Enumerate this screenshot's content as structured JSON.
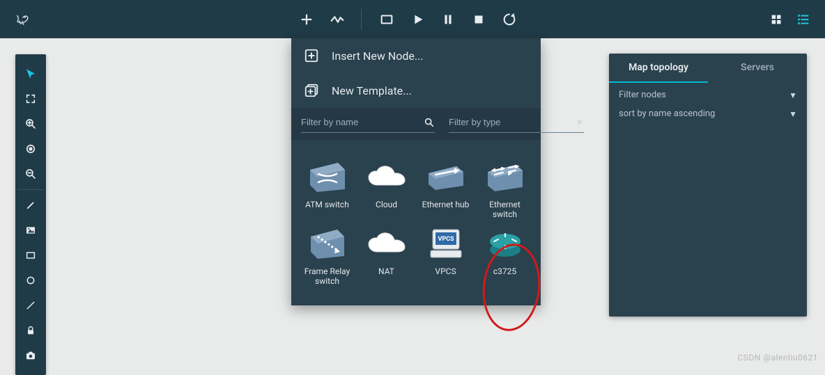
{
  "toolbar": {
    "icons": [
      "add",
      "activity",
      "fit",
      "play",
      "pause",
      "stop",
      "reload"
    ],
    "right_icons": [
      "grid-view",
      "menu"
    ]
  },
  "sidebar": {
    "groups": [
      [
        "cursor",
        "fullscreen",
        "zoom-in",
        "target",
        "zoom-out"
      ],
      [
        "pencil",
        "image",
        "rectangle",
        "circle",
        "line",
        "lock",
        "camera"
      ]
    ]
  },
  "dropdown": {
    "items": [
      {
        "icon": "insert-node",
        "label": "Insert New Node..."
      },
      {
        "icon": "new-template",
        "label": "New Template..."
      }
    ],
    "filter_name_placeholder": "Filter by name",
    "filter_type_placeholder": "Filter by type",
    "nodes": [
      {
        "id": "atm-switch",
        "label": "ATM switch",
        "shape": "switch-blue"
      },
      {
        "id": "cloud",
        "label": "Cloud",
        "shape": "cloud"
      },
      {
        "id": "ethernet-hub",
        "label": "Ethernet hub",
        "shape": "hub-blue"
      },
      {
        "id": "ethernet-switch",
        "label": "Ethernet switch",
        "shape": "switch-arrows"
      },
      {
        "id": "frame-relay",
        "label": "Frame Relay switch",
        "shape": "fr-switch"
      },
      {
        "id": "nat",
        "label": "NAT",
        "shape": "cloud"
      },
      {
        "id": "vpcs",
        "label": "VPCS",
        "shape": "vpcs"
      },
      {
        "id": "c3725",
        "label": "c3725",
        "shape": "router-teal"
      }
    ]
  },
  "rightpanel": {
    "tabs": [
      {
        "id": "map",
        "label": "Map topology",
        "active": true
      },
      {
        "id": "servers",
        "label": "Servers",
        "active": false
      }
    ],
    "filter_label": "Filter nodes",
    "sort_label": "sort by name ascending"
  },
  "watermark": "CSDN @alenliu0621"
}
